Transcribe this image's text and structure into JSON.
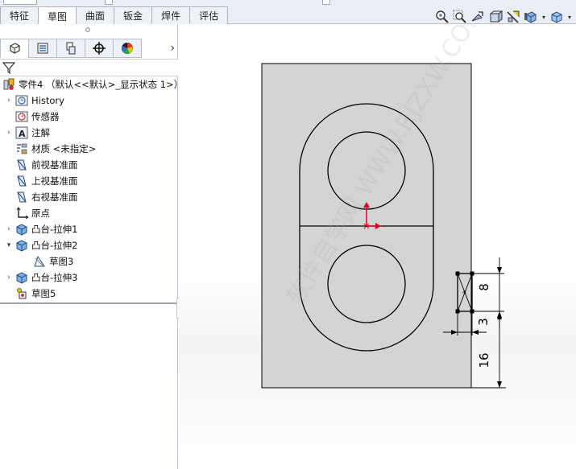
{
  "tabs": [
    "特征",
    "草图",
    "曲面",
    "钣金",
    "焊件",
    "评估"
  ],
  "active_tab": "草图",
  "hud_icons": [
    "zoom-fit-icon",
    "zoom-area-icon",
    "previous-view-icon",
    "section-view-icon",
    "view-orientation-icon",
    "display-style-icon",
    "hide-show-icon"
  ],
  "pm_tabs": [
    "feature-manager-icon",
    "property-manager-icon",
    "configuration-manager-icon",
    "dimxpert-icon",
    "display-manager-icon"
  ],
  "tree": {
    "root": "零件4 （默认<<默认>_显示状态 1>）",
    "items": [
      {
        "label": "History",
        "icon": "history-icon",
        "expandable": true
      },
      {
        "label": "传感器",
        "icon": "sensor-icon",
        "expandable": false
      },
      {
        "label": "注解",
        "icon": "annotation-icon",
        "expandable": true
      },
      {
        "label": "材质 <未指定>",
        "icon": "material-icon",
        "expandable": false
      },
      {
        "label": "前视基准面",
        "icon": "plane-icon",
        "expandable": false
      },
      {
        "label": "上视基准面",
        "icon": "plane-icon",
        "expandable": false
      },
      {
        "label": "右视基准面",
        "icon": "plane-icon",
        "expandable": false
      },
      {
        "label": "原点",
        "icon": "origin-icon",
        "expandable": false
      },
      {
        "label": "凸台-拉伸1",
        "icon": "extrude-icon",
        "expandable": true
      },
      {
        "label": "凸台-拉伸2",
        "icon": "extrude-icon",
        "expandable": true,
        "expanded": true
      },
      {
        "label": "草图3",
        "icon": "sketch-icon",
        "expandable": false,
        "child": true
      },
      {
        "label": "凸台-拉伸3",
        "icon": "extrude-icon",
        "expandable": true
      },
      {
        "label": "草图5",
        "icon": "sketch-active-icon",
        "expandable": false
      }
    ]
  },
  "dimensions": [
    "8",
    "3",
    "16"
  ],
  "watermark": "软件自学网 WWW.RJZXW.COM",
  "colors": {
    "part_face": "#d4d4d4",
    "sketch_line": "#000000",
    "origin": "#e0001b",
    "tab_bg": "#eef2f7"
  }
}
